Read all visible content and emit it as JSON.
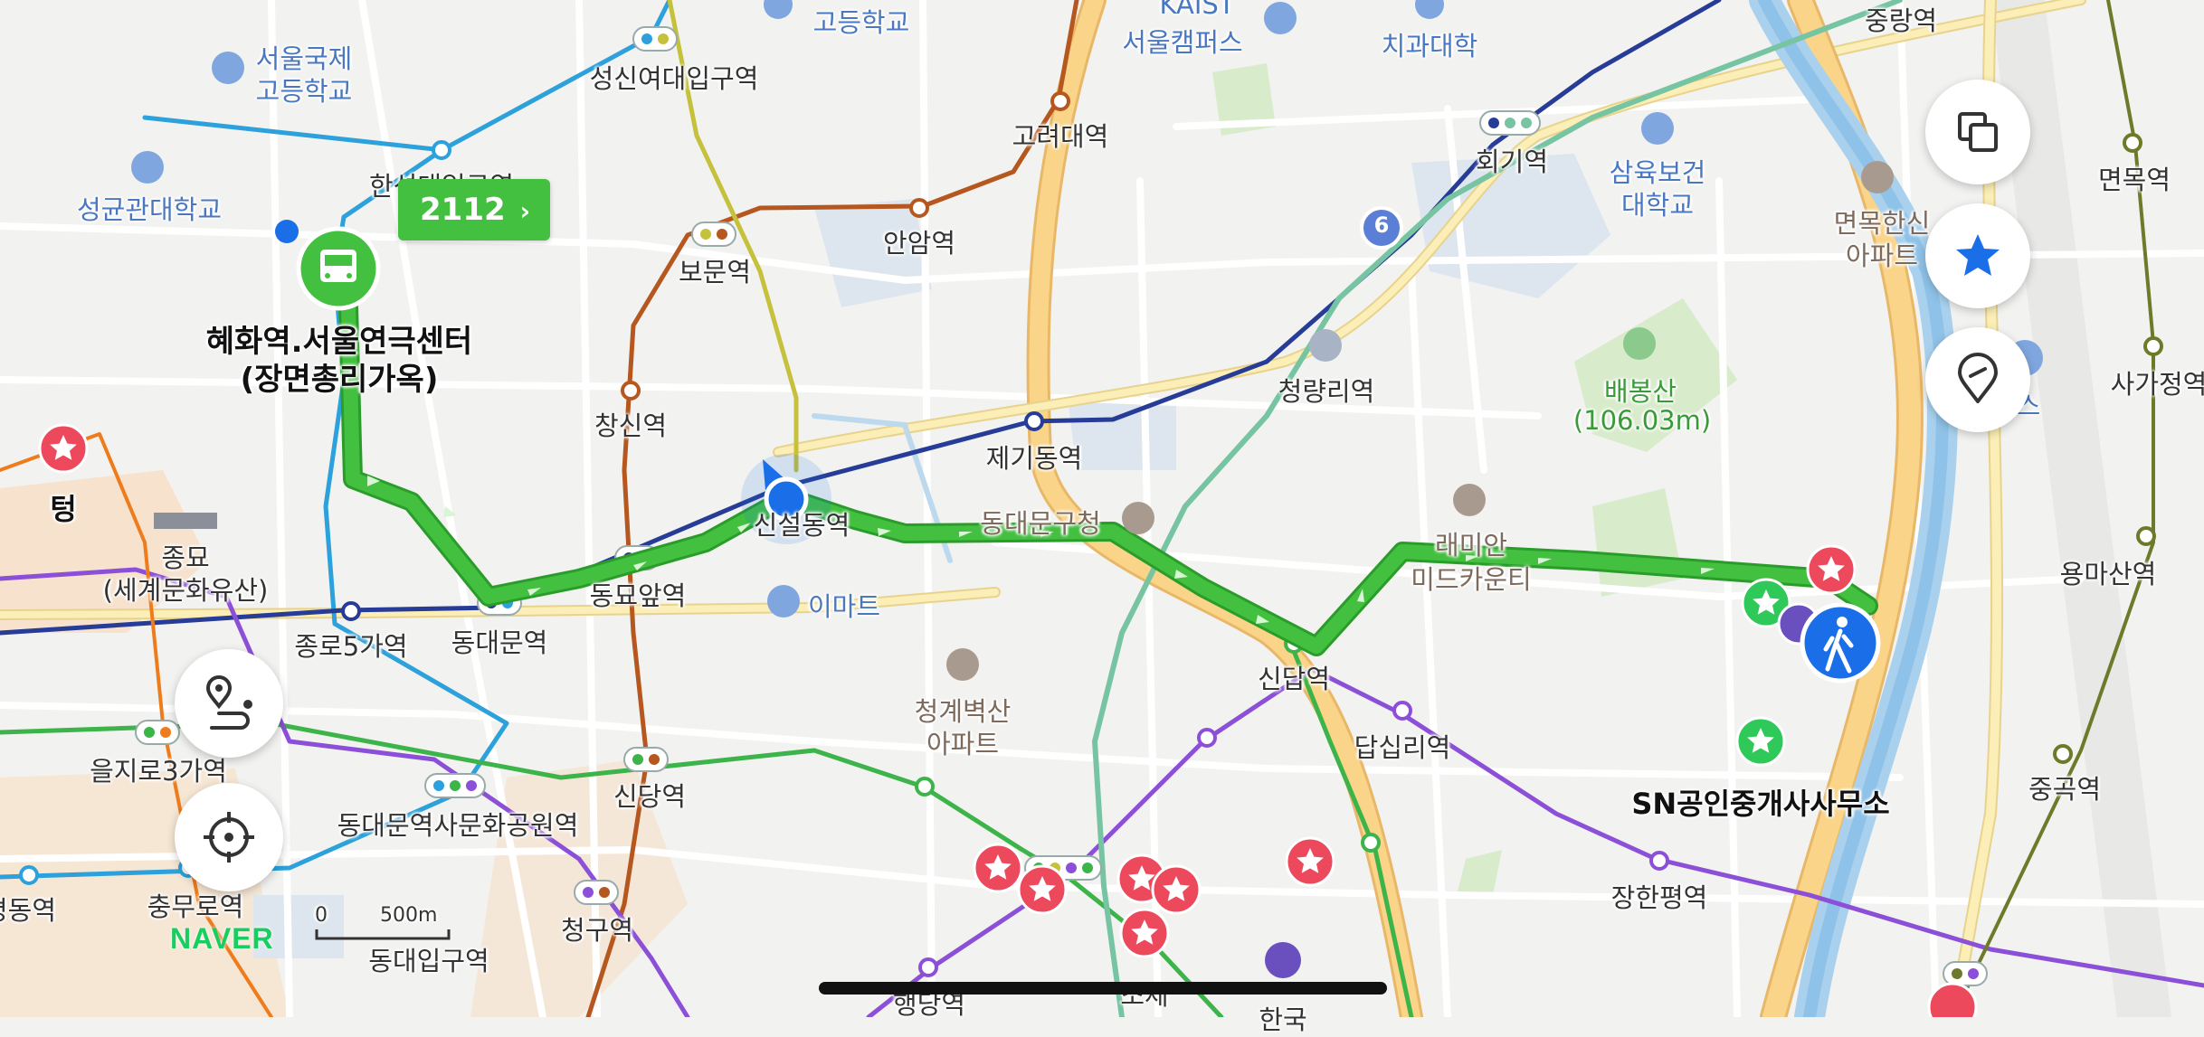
{
  "map": {
    "place_labels": [
      {
        "text": "서울국제",
        "cls": "blue"
      },
      {
        "text": "고등학교",
        "cls": "blue"
      },
      {
        "text": "성균관대학교",
        "cls": "blue"
      },
      {
        "text": "고등학교",
        "cls": "blue"
      },
      {
        "text": "KAIST",
        "cls": "blue"
      },
      {
        "text": "서울캠퍼스",
        "cls": "blue"
      },
      {
        "text": "치과대학",
        "cls": "blue"
      },
      {
        "text": "삼육보건",
        "cls": "blue"
      },
      {
        "text": "대학교",
        "cls": "blue"
      },
      {
        "text": "면목한신",
        "cls": "brown"
      },
      {
        "text": "아파트",
        "cls": "brown"
      },
      {
        "text": "배봉산",
        "cls": "green"
      },
      {
        "text": "(106.03m)",
        "cls": "green"
      },
      {
        "text": "청량리역",
        "cls": ""
      },
      {
        "text": "래미안",
        "cls": "brown"
      },
      {
        "text": "미드카운티",
        "cls": "brown"
      },
      {
        "text": "동대문구청",
        "cls": "brown"
      },
      {
        "text": "이마트",
        "cls": "blue"
      },
      {
        "text": "청계벽산",
        "cls": "brown"
      },
      {
        "text": "아파트",
        "cls": "brown"
      },
      {
        "text": "종묘",
        "cls": ""
      },
      {
        "text": "(세계문화유산)",
        "cls": ""
      },
      {
        "text": "텅",
        "cls": "bold"
      },
      {
        "text": "SN공인중개사사무소",
        "cls": "bold"
      },
      {
        "text": "서스",
        "cls": "blue"
      },
      {
        "text": "한국",
        "cls": ""
      },
      {
        "text": "소제",
        "cls": ""
      }
    ],
    "station_labels": [
      "성신여대입구역",
      "한성대입구역",
      "고려대역",
      "안암역",
      "보문역",
      "창신역",
      "제기동역",
      "회기역",
      "중랑역",
      "면목역",
      "사가정역",
      "용마산역",
      "중곡역",
      "신설동역",
      "동묘앞역",
      "동대문역",
      "종로5가역",
      "을지로3가역",
      "동대문역사문화공원역",
      "신당역",
      "신답역",
      "답십리역",
      "장한평역",
      "충무로역",
      "청구역",
      "동대입구역",
      "행당역",
      "명동역"
    ],
    "stop_name_line1": "혜화역.서울연극센터",
    "stop_name_line2": "(장면총리가옥)",
    "bus_number": "2112",
    "bus_chevron": "›",
    "line_badge": "6",
    "scale_zero": "0",
    "scale_distance": "500m",
    "logo": "NAVER"
  },
  "controls": {
    "layers_icon": "layers-icon",
    "favorites_icon": "star-icon",
    "location_pin_icon": "pin-icon",
    "route_icon": "route-icon",
    "my_location_icon": "crosshair-icon"
  },
  "colors": {
    "route_green": "#38b938",
    "line1_navy": "#263c96",
    "line2_green": "#3cb44a",
    "line4_skyblue": "#2ca1db",
    "line5_purple": "#8b50d7",
    "line6_brown": "#b5571e",
    "gyeongui_teal": "#77c4a3",
    "ui_sinseol_yellow": "#c6c13c",
    "line3_orange": "#ef7c1c",
    "major_road": "#f6c97a",
    "favorite_red": "#ec4a5c",
    "current_location_blue": "#1a6fe8"
  }
}
